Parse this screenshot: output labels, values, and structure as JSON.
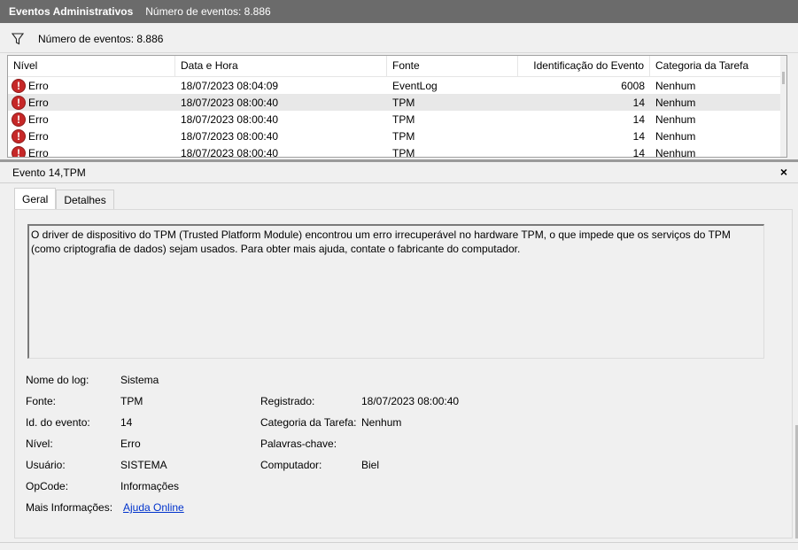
{
  "title_bar": {
    "title": "Eventos Administrativos",
    "count": "Número de eventos: 8.886"
  },
  "filter_bar": {
    "icon": "filter-icon",
    "count": "Número de eventos: 8.886"
  },
  "grid": {
    "columns": [
      "Nível",
      "Data e Hora",
      "Fonte",
      "Identificação do Evento",
      "Categoria da Tarefa"
    ],
    "rows": [
      {
        "level": "Erro",
        "date": "18/07/2023 08:04:09",
        "source": "EventLog",
        "id": "6008",
        "category": "Nenhum"
      },
      {
        "level": "Erro",
        "date": "18/07/2023 08:00:40",
        "source": "TPM",
        "id": "14",
        "category": "Nenhum"
      },
      {
        "level": "Erro",
        "date": "18/07/2023 08:00:40",
        "source": "TPM",
        "id": "14",
        "category": "Nenhum"
      },
      {
        "level": "Erro",
        "date": "18/07/2023 08:00:40",
        "source": "TPM",
        "id": "14",
        "category": "Nenhum"
      },
      {
        "level": "Erro",
        "date": "18/07/2023 08:00:40",
        "source": "TPM",
        "id": "14",
        "category": "Nenhum"
      }
    ],
    "error_glyph": "!"
  },
  "detail": {
    "title": "Evento 14,TPM",
    "close_glyph": "×",
    "tabs": [
      "Geral",
      "Detalhes"
    ],
    "description": "O driver de dispositivo do TPM (Trusted Platform Module) encontrou um erro irrecuperável no hardware TPM, o que impede que os serviços do TPM (como criptografia de dados) sejam usados. Para obter mais ajuda, contate o fabricante do computador.",
    "props": {
      "log_label": "Nome do log:",
      "log_value": "Sistema",
      "source_label": "Fonte:",
      "source_value": "TPM",
      "registered_label": "Registrado:",
      "registered_value": "18/07/2023 08:00:40",
      "event_id_label": "Id. do evento:",
      "event_id_value": "14",
      "task_cat_label": "Categoria da Tarefa:",
      "task_cat_value": "Nenhum",
      "level_label": "Nível:",
      "level_value": "Erro",
      "keywords_label": "Palavras-chave:",
      "user_label": "Usuário:",
      "user_value": "SISTEMA",
      "computer_label": "Computador:",
      "computer_value": "Biel",
      "opcode_label": "OpCode:",
      "opcode_value": "Informações",
      "more_info_label": "Mais Informações:",
      "more_info_link": "Ajuda Online"
    }
  },
  "colors": {
    "title_bar": "#6b6b6b",
    "error": "#c62828",
    "link": "#0033cc",
    "selected_row": "#e8e8e8"
  }
}
